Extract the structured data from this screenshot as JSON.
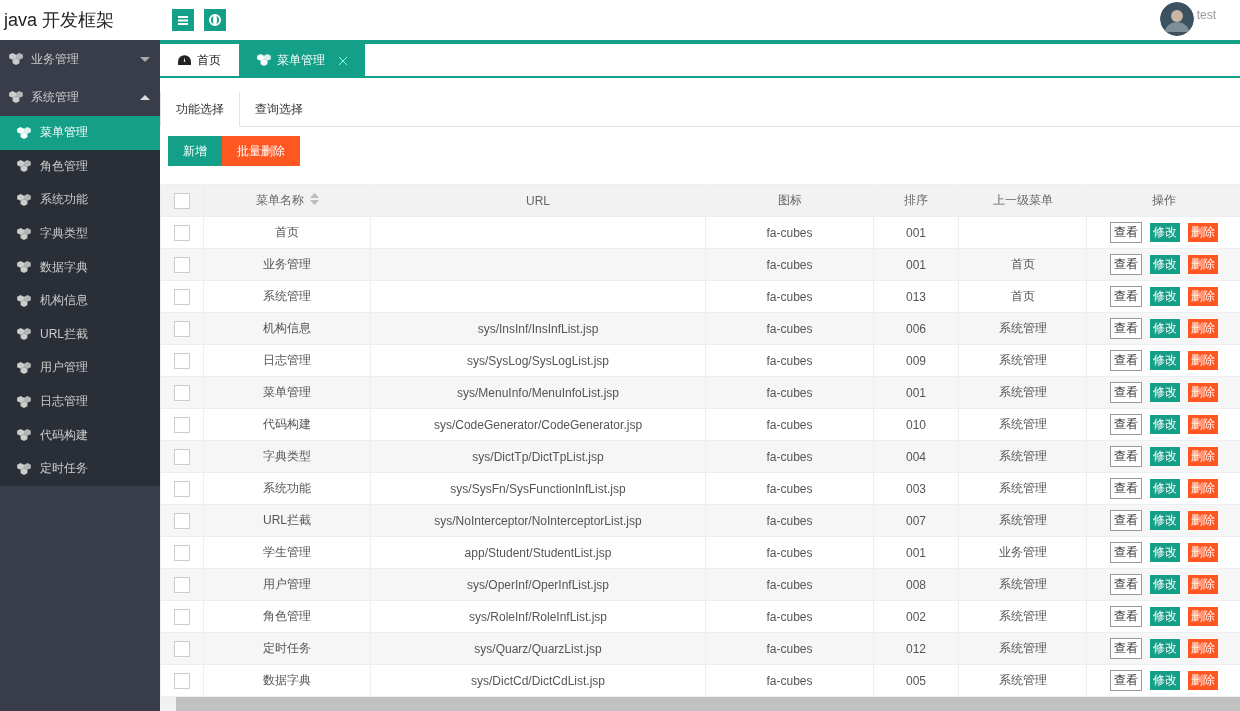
{
  "header": {
    "title": "java 开发框架",
    "user": "test"
  },
  "sidebar": {
    "items": [
      {
        "label": "业务管理",
        "expanded": false
      },
      {
        "label": "系统管理",
        "expanded": true,
        "children": [
          {
            "label": "菜单管理",
            "selected": true
          },
          {
            "label": "角色管理",
            "selected": false
          },
          {
            "label": "系统功能",
            "selected": false
          },
          {
            "label": "字典类型",
            "selected": false
          },
          {
            "label": "数据字典",
            "selected": false
          },
          {
            "label": "机构信息",
            "selected": false
          },
          {
            "label": "URL拦截",
            "selected": false
          },
          {
            "label": "用户管理",
            "selected": false
          },
          {
            "label": "日志管理",
            "selected": false
          },
          {
            "label": "代码构建",
            "selected": false
          },
          {
            "label": "定时任务",
            "selected": false
          }
        ]
      }
    ]
  },
  "page_tabs": [
    {
      "label": "首页",
      "kind": "home",
      "selected": false,
      "closable": false
    },
    {
      "label": "菜单管理",
      "kind": "cubes",
      "selected": true,
      "closable": true
    }
  ],
  "sub_tabs": [
    {
      "label": "功能选择",
      "selected": true
    },
    {
      "label": "查询选择",
      "selected": false
    }
  ],
  "buttons": [
    {
      "label": "新增",
      "kind": "primary"
    },
    {
      "label": "批量删除",
      "kind": "danger"
    }
  ],
  "table": {
    "select_all_checked": false,
    "columns": [
      "菜单名称",
      "URL",
      "图标",
      "排序",
      "上一级菜单",
      "操作"
    ],
    "rows": [
      {
        "checked": false,
        "cells": [
          "首页",
          "",
          "fa-cubes",
          "001",
          ""
        ],
        "actions": [
          "查看",
          "修改",
          "删除"
        ]
      },
      {
        "checked": false,
        "cells": [
          "业务管理",
          "",
          "fa-cubes",
          "001",
          "首页"
        ],
        "actions": [
          "查看",
          "修改",
          "删除"
        ]
      },
      {
        "checked": false,
        "cells": [
          "系统管理",
          "",
          "fa-cubes",
          "013",
          "首页"
        ],
        "actions": [
          "查看",
          "修改",
          "删除"
        ]
      },
      {
        "checked": false,
        "cells": [
          "机构信息",
          "sys/InsInf/InsInfList.jsp",
          "fa-cubes",
          "006",
          "系统管理"
        ],
        "actions": [
          "查看",
          "修改",
          "删除"
        ]
      },
      {
        "checked": false,
        "cells": [
          "日志管理",
          "sys/SysLog/SysLogList.jsp",
          "fa-cubes",
          "009",
          "系统管理"
        ],
        "actions": [
          "查看",
          "修改",
          "删除"
        ]
      },
      {
        "checked": false,
        "cells": [
          "菜单管理",
          "sys/MenuInfo/MenuInfoList.jsp",
          "fa-cubes",
          "001",
          "系统管理"
        ],
        "actions": [
          "查看",
          "修改",
          "删除"
        ]
      },
      {
        "checked": false,
        "cells": [
          "代码构建",
          "sys/CodeGenerator/CodeGenerator.jsp",
          "fa-cubes",
          "010",
          "系统管理"
        ],
        "actions": [
          "查看",
          "修改",
          "删除"
        ]
      },
      {
        "checked": false,
        "cells": [
          "字典类型",
          "sys/DictTp/DictTpList.jsp",
          "fa-cubes",
          "004",
          "系统管理"
        ],
        "actions": [
          "查看",
          "修改",
          "删除"
        ]
      },
      {
        "checked": false,
        "cells": [
          "系统功能",
          "sys/SysFn/SysFunctionInfList.jsp",
          "fa-cubes",
          "003",
          "系统管理"
        ],
        "actions": [
          "查看",
          "修改",
          "删除"
        ]
      },
      {
        "checked": false,
        "cells": [
          "URL拦截",
          "sys/NoInterceptor/NoInterceptorList.jsp",
          "fa-cubes",
          "007",
          "系统管理"
        ],
        "actions": [
          "查看",
          "修改",
          "删除"
        ]
      },
      {
        "checked": false,
        "cells": [
          "学生管理",
          "app/Student/StudentList.jsp",
          "fa-cubes",
          "001",
          "业务管理"
        ],
        "actions": [
          "查看",
          "修改",
          "删除"
        ]
      },
      {
        "checked": false,
        "cells": [
          "用户管理",
          "sys/OperInf/OperInfList.jsp",
          "fa-cubes",
          "008",
          "系统管理"
        ],
        "actions": [
          "查看",
          "修改",
          "删除"
        ]
      },
      {
        "checked": false,
        "cells": [
          "角色管理",
          "sys/RoleInf/RoleInfList.jsp",
          "fa-cubes",
          "002",
          "系统管理"
        ],
        "actions": [
          "查看",
          "修改",
          "删除"
        ]
      },
      {
        "checked": false,
        "cells": [
          "定时任务",
          "sys/Quarz/QuarzList.jsp",
          "fa-cubes",
          "012",
          "系统管理"
        ],
        "actions": [
          "查看",
          "修改",
          "删除"
        ]
      },
      {
        "checked": false,
        "cells": [
          "数据字典",
          "sys/DictCd/DictCdList.jsp",
          "fa-cubes",
          "005",
          "系统管理"
        ],
        "actions": [
          "查看",
          "修改",
          "删除"
        ]
      }
    ]
  }
}
